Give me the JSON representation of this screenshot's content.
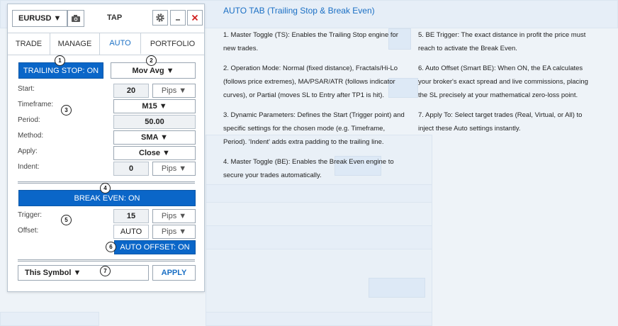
{
  "header": {
    "symbol": "EURUSD ▼",
    "title": "TAP"
  },
  "tabs": [
    {
      "label": "TRADE"
    },
    {
      "label": "MANAGE"
    },
    {
      "label": "AUTO"
    },
    {
      "label": "PORTFOLIO"
    }
  ],
  "trailing": {
    "toggle_label": "TRAILING STOP: ON",
    "mode": "Mov Avg ▼",
    "start_label": "Start:",
    "start_value": "20",
    "start_unit": "Pips ▼",
    "timeframe_label": "Timeframe:",
    "timeframe_value": "M15 ▼",
    "period_label": "Period:",
    "period_value": "50.00",
    "method_label": "Method:",
    "method_value": "SMA ▼",
    "apply_label": "Apply:",
    "apply_value": "Close ▼",
    "indent_label": "Indent:",
    "indent_value": "0",
    "indent_unit": "Pips ▼"
  },
  "breakeven": {
    "toggle_label": "BREAK EVEN: ON",
    "trigger_label": "Trigger:",
    "trigger_value": "15",
    "trigger_unit": "Pips ▼",
    "offset_label": "Offset:",
    "offset_value": "AUTO",
    "offset_unit": "Pips ▼",
    "auto_offset_label": "AUTO OFFSET: ON"
  },
  "footer": {
    "target": "This Symbol ▼",
    "apply_button": "APPLY"
  },
  "markers": [
    "1",
    "2",
    "3",
    "4",
    "5",
    "6",
    "7"
  ],
  "doc": {
    "title": "AUTO TAB (Trailing Stop & Break Even)",
    "col1": [
      "1. Master Toggle (TS): Enables the Trailing Stop engine for new trades.",
      "2. Operation Mode: Normal (fixed distance), Fractals/Hi-Lo (follows price extremes), MA/PSAR/ATR (follows indicator curves), or Partial (moves SL to Entry after TP1 is hit).",
      "3. Dynamic Parameters: Defines the Start (Trigger point) and specific settings for the chosen mode (e.g. Timeframe, Period). 'Indent' adds extra padding to the trailing line.",
      "4. Master Toggle (BE): Enables the Break Even engine to secure your trades automatically."
    ],
    "col2": [
      "5. BE Trigger: The exact distance in profit the price must reach to activate the Break Even.",
      "6. Auto Offset (Smart BE): When ON, the EA calculates your broker's exact spread and live commissions, placing the SL precisely at your mathematical zero-loss point.",
      "7. Apply To: Select target trades (Real, Virtual, or All) to inject these Auto settings instantly."
    ]
  },
  "colors": {
    "accent": "#0a66c8",
    "link": "#1a6fc4",
    "close": "#d01c1c"
  }
}
